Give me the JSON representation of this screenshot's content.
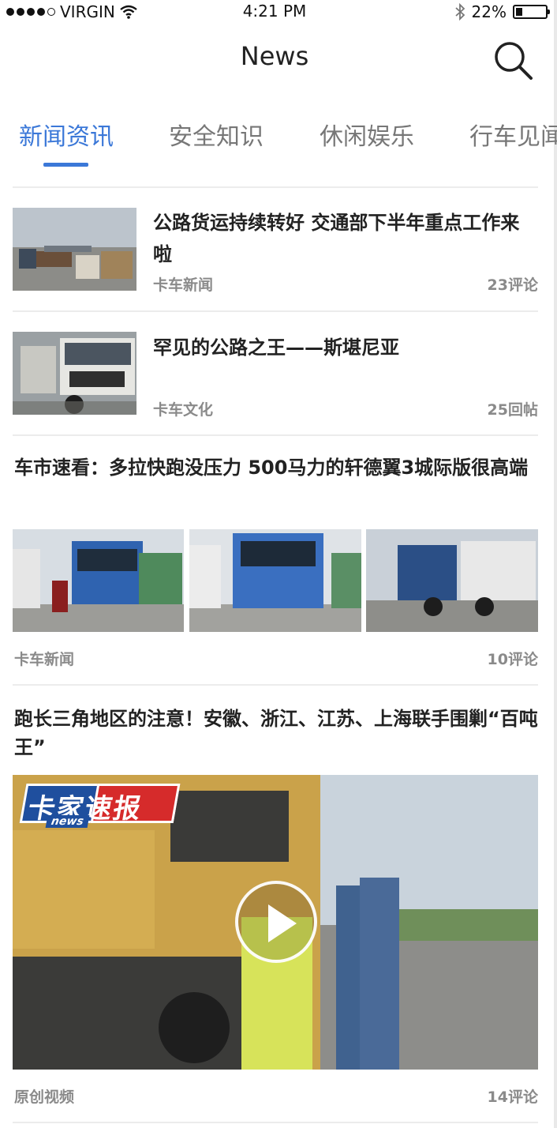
{
  "status_bar": {
    "carrier": "VIRGIN",
    "time": "4:21 PM",
    "battery": "22%",
    "battery_level": 0.22,
    "signal_icon": "signal-dots-icon",
    "wifi_icon": "wifi-icon",
    "bluetooth_icon": "bluetooth-icon"
  },
  "nav": {
    "title": "News",
    "search_icon": "search-icon"
  },
  "tabs": [
    {
      "label": "新闻资讯",
      "active": true
    },
    {
      "label": "安全知识",
      "active": false
    },
    {
      "label": "休闲娱乐",
      "active": false
    },
    {
      "label": "行车见闻",
      "active": false
    }
  ],
  "accent_color": "#3b78d8",
  "articles": [
    {
      "title": "公路货运持续转好 交通部下半年重点工作来啦",
      "source": "卡车新闻",
      "comments": "23评论",
      "image": "truck-yard-photo"
    },
    {
      "title": "罕见的公路之王——斯堪尼亚",
      "source": "卡车文化",
      "comments": "25回帖",
      "image": "scania-truck-photo"
    },
    {
      "title": "车市速看：多拉快跑没压力 500马力的轩德翼3城际版很高端",
      "source": "卡车新闻",
      "comments": "10评论",
      "images": [
        "blue-truck-expo-photo-1",
        "blue-truck-expo-photo-2",
        "tractor-unit-photo-3"
      ]
    },
    {
      "title": "跑长三角地区的注意！安徽、浙江、江苏、上海联手围剿“百吨王”",
      "source": "原创视频",
      "comments": "14评论",
      "video_thumbnail": "roadside-truck-inspection-photo",
      "overlay_logo_text": "卡家速报",
      "overlay_logo_sub": "news",
      "play_icon": "play-icon"
    }
  ]
}
